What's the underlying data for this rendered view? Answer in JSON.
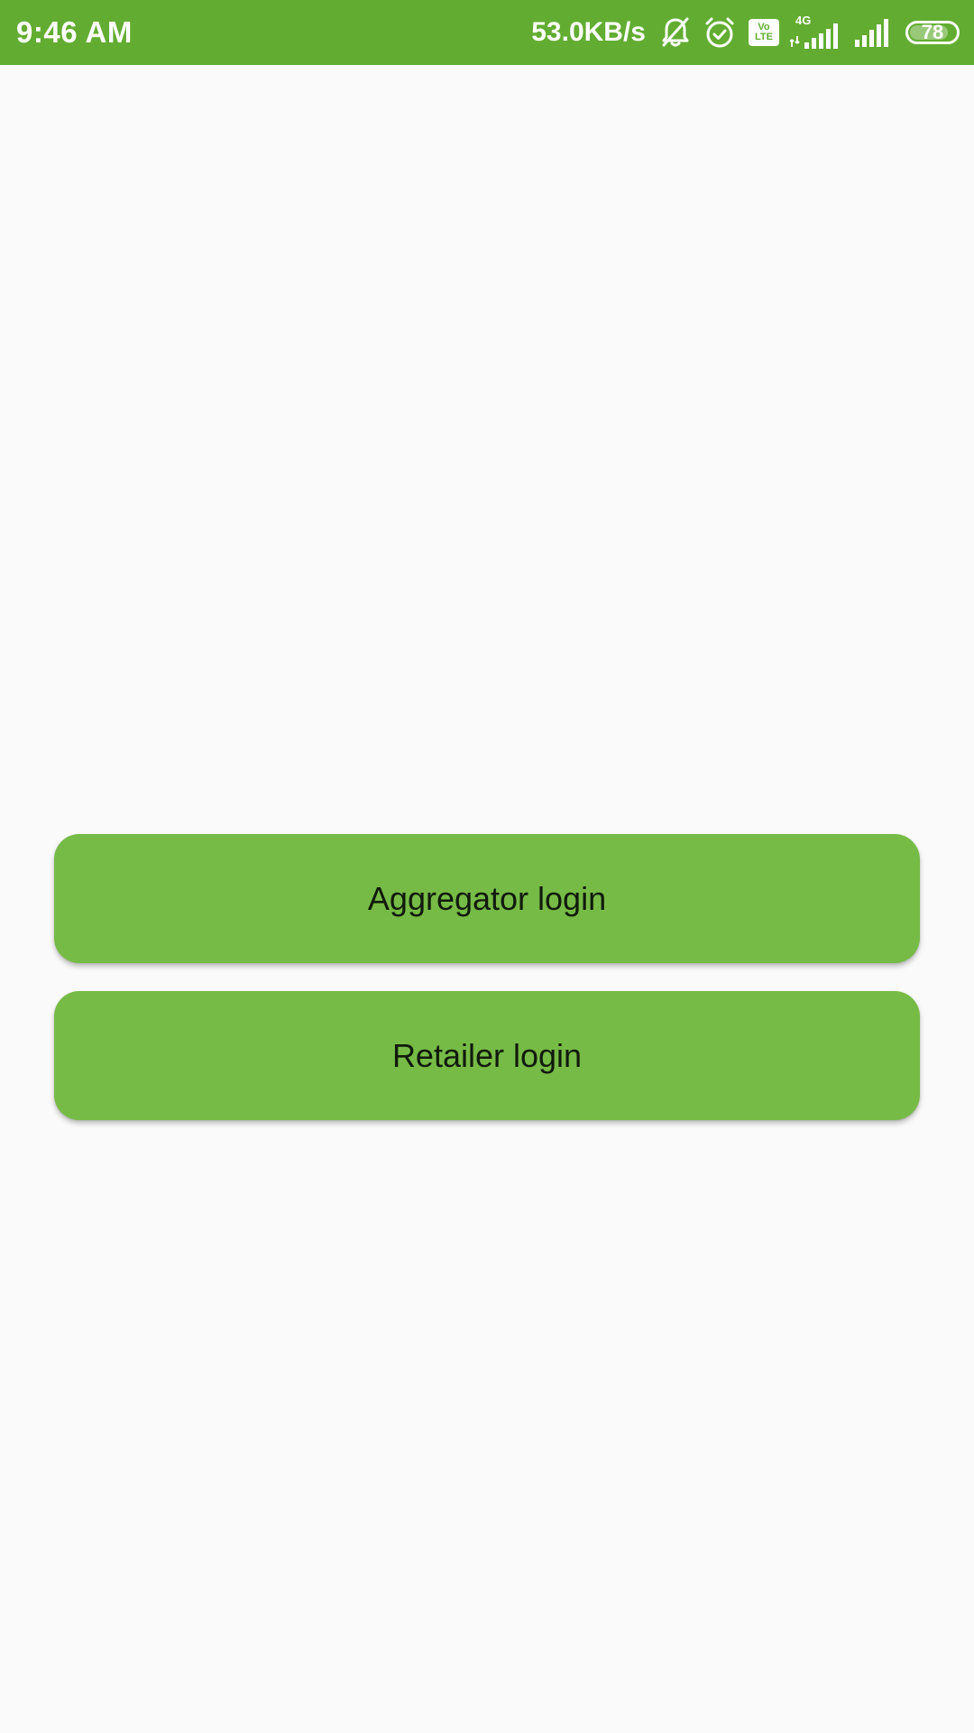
{
  "status_bar": {
    "time": "9:46 AM",
    "net_speed": "53.0KB/s",
    "network_type": "4G",
    "volte_top": "Vo",
    "volte_bottom": "LTE",
    "battery_level": "78",
    "background_color": "#62ad31",
    "icons": [
      "bell-off-icon",
      "alarm-icon",
      "volte-icon",
      "signal-icon",
      "signal-icon",
      "battery-icon"
    ]
  },
  "main": {
    "aggregator_login_label": "Aggregator login",
    "retailer_login_label": "Retailer login",
    "button_color": "#76bb46",
    "background_color": "#fafafa"
  }
}
